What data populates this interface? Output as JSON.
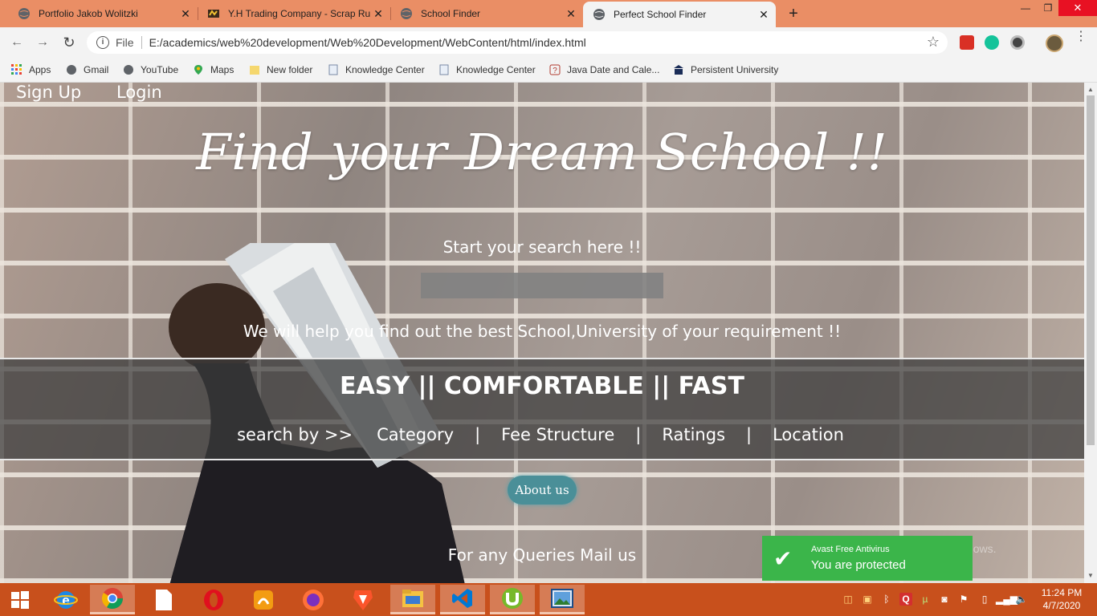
{
  "browser": {
    "tabs": [
      {
        "title": "Portfolio Jakob Wolitzki",
        "active": false
      },
      {
        "title": "Y.H Trading Company - Scrap Ru",
        "active": false
      },
      {
        "title": "School Finder",
        "active": false
      },
      {
        "title": "Perfect School Finder",
        "active": true
      }
    ],
    "new_tab": "+",
    "url_scheme": "File",
    "url": "E:/academics/web%20development/Web%20Development/WebContent/html/index.html",
    "bookmarks": [
      "Apps",
      "Gmail",
      "YouTube",
      "Maps",
      "New folder",
      "Knowledge Center",
      "Knowledge Center",
      "Java Date and Cale...",
      "Persistent University"
    ]
  },
  "page": {
    "nav": {
      "signup": "Sign Up",
      "login": "Login"
    },
    "hero_title": "Find your Dream School !!",
    "search_label": "Start your search here !!",
    "search_value": "",
    "tagline": "We will help you find out the best School,University of your requirement !!",
    "band": {
      "title": "EASY || COMFORTABLE || FAST",
      "search_by": "search by >>",
      "options": [
        "Category",
        "Fee Structure",
        "Ratings",
        "Location"
      ],
      "separator": "|"
    },
    "about_button": "About us",
    "queries": "For any Queries Mail us"
  },
  "notification": {
    "app": "Avast Free Antivirus",
    "message": "You are protected"
  },
  "watermark": "settings to activate Windows.",
  "taskbar": {
    "time": "11:24 PM",
    "date": "4/7/2020"
  },
  "colors": {
    "tabstrip": "#ea8e65",
    "taskbar": "#c8501c",
    "toast": "#3bb54a",
    "about_button": "#4a8f98"
  }
}
